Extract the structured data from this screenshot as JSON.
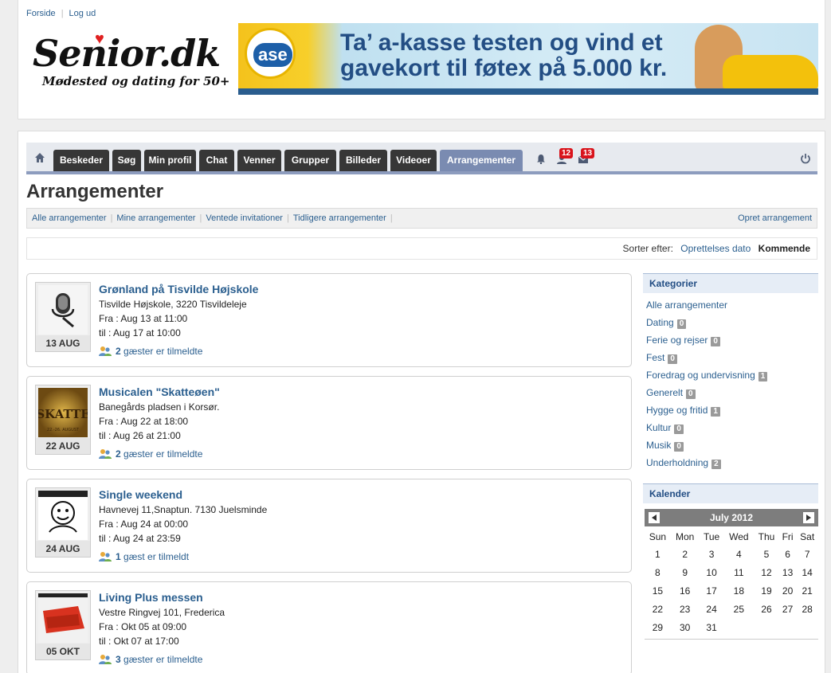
{
  "toplinks": {
    "home": "Forside",
    "logout": "Log ud"
  },
  "logo": {
    "word": "Senior.dk",
    "tagline": "Mødested og dating for 50+"
  },
  "banner": {
    "brand": "ase",
    "line1": "Ta’ a-kasse testen og vind et",
    "line2": "gavekort til føtex på 5.000 kr."
  },
  "nav": {
    "tabs": [
      "Beskeder",
      "Søg",
      "Min profil",
      "Chat",
      "Venner",
      "Grupper",
      "Billeder",
      "Videoer",
      "Arrangementer"
    ],
    "active": "Arrangementer",
    "notif_badge_1": "12",
    "notif_badge_2": "13"
  },
  "page_title": "Arrangementer",
  "subnav": {
    "items": [
      "Alle arrangementer",
      "Mine arrangementer",
      "Ventede invitationer",
      "Tidligere arrangementer"
    ],
    "create": "Opret arrangement"
  },
  "sort": {
    "label": "Sorter efter:",
    "option1": "Oprettelses dato",
    "option2": "Kommende"
  },
  "events": [
    {
      "title": "Grønland på Tisvilde Højskole",
      "place": "Tisvilde Højskole, 3220 Tisvildeleje",
      "from": "Fra : Aug 13 at 11:00",
      "to": "til : Aug 17 at 10:00",
      "date": "13 AUG",
      "guests_count": "2",
      "guests_text": "gæster er tilmeldte"
    },
    {
      "title": "Musicalen \"Skatteøen\"",
      "place": "Banegårds pladsen i Korsør.",
      "from": "Fra : Aug 22 at 18:00",
      "to": "til : Aug 26 at 21:00",
      "date": "22 AUG",
      "guests_count": "2",
      "guests_text": "gæster er tilmeldte"
    },
    {
      "title": "Single weekend",
      "place": "Havnevej 11,Snaptun. 7130 Juelsminde",
      "from": "Fra : Aug 24 at 00:00",
      "to": "til : Aug 24 at 23:59",
      "date": "24 AUG",
      "guests_count": "1",
      "guests_text": "gæst er tilmeldt"
    },
    {
      "title": "Living Plus messen",
      "place": "Vestre Ringvej 101, Frederica",
      "from": "Fra : Okt 05 at 09:00",
      "to": "til : Okt 07 at 17:00",
      "date": "05 OKT",
      "guests_count": "3",
      "guests_text": "gæster er tilmeldte"
    }
  ],
  "categories": {
    "heading": "Kategorier",
    "items": [
      {
        "label": "Alle arrangementer",
        "count": ""
      },
      {
        "label": "Dating",
        "count": "0"
      },
      {
        "label": "Ferie og rejser",
        "count": "0"
      },
      {
        "label": "Fest",
        "count": "0"
      },
      {
        "label": "Foredrag og undervisning",
        "count": "1"
      },
      {
        "label": "Generelt",
        "count": "0"
      },
      {
        "label": "Hygge og fritid",
        "count": "1"
      },
      {
        "label": "Kultur",
        "count": "0"
      },
      {
        "label": "Musik",
        "count": "0"
      },
      {
        "label": "Underholdning",
        "count": "2"
      }
    ]
  },
  "calendar": {
    "heading": "Kalender",
    "month": "July 2012",
    "weekdays": [
      "Sun",
      "Mon",
      "Tue",
      "Wed",
      "Thu",
      "Fri",
      "Sat"
    ],
    "weeks": [
      [
        "1",
        "2",
        "3",
        "4",
        "5",
        "6",
        "7"
      ],
      [
        "8",
        "9",
        "10",
        "11",
        "12",
        "13",
        "14"
      ],
      [
        "15",
        "16",
        "17",
        "18",
        "19",
        "20",
        "21"
      ],
      [
        "22",
        "23",
        "24",
        "25",
        "26",
        "27",
        "28"
      ],
      [
        "29",
        "30",
        "31",
        "",
        "",
        "",
        ""
      ]
    ]
  }
}
